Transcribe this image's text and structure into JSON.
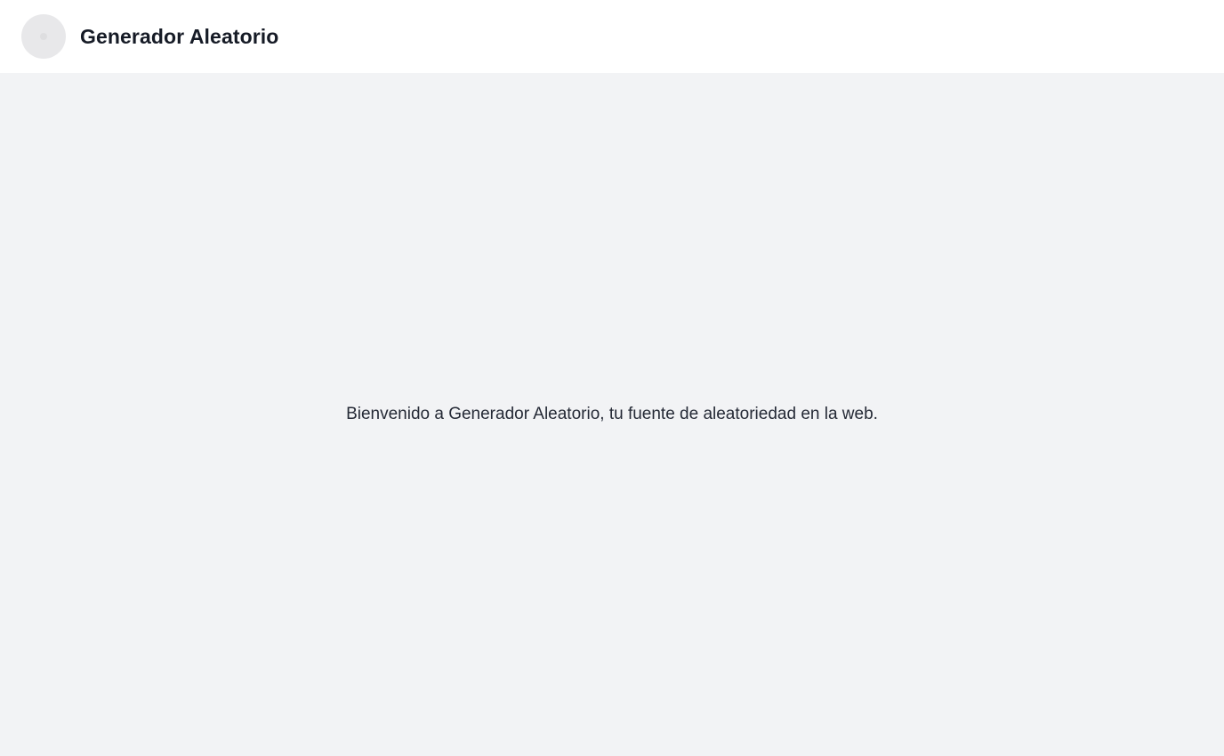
{
  "header": {
    "logo_icon": "logo-circle-icon",
    "title": "Generador Aleatorio"
  },
  "main": {
    "welcome_text": "Bienvenido a Generador Aleatorio, tu fuente de aleatoriedad en la web."
  },
  "colors": {
    "header_bg": "#ffffff",
    "page_bg": "#f2f3f5",
    "title_text": "#161b26",
    "body_text": "#252a36",
    "logo_bg": "#e8e8ea"
  }
}
